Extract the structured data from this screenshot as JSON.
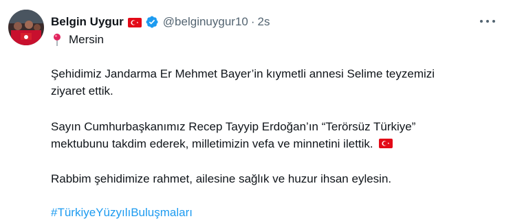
{
  "author": {
    "name": "Belgin Uygur",
    "handle": "@belginuygur10",
    "separator": "·",
    "time": "2s",
    "verified": true,
    "flag_icon": "turkey-flag-icon"
  },
  "location": {
    "icon": "round-pushpin-icon",
    "label": "Mersin"
  },
  "body": {
    "line1": "Şehidimiz Jandarma Er Mehmet Bayer’in kıymetli annesi Selime teyzemizi",
    "line2": "ziyaret ettik.",
    "line3": "Sayın Cumhurbaşkanımız Recep Tayyip Erdoğan’ın “Terörsüz Türkiye”",
    "line4": "mektubunu takdim ederek, milletimizin vefa ve minnetini ilettik.",
    "line5": "Rabbim şehidimize rahmet, ailesine sağlık ve huzur ihsan eylesin.",
    "hashtag": "#TürkiyeYüzyılıBuluşmaları"
  },
  "colors": {
    "text": "#0f1419",
    "muted": "#536471",
    "link": "#1d9bf0",
    "verified": "#1d9bf0",
    "flag_red": "#e30a17"
  },
  "more_icon": "more-horizontal-icon"
}
